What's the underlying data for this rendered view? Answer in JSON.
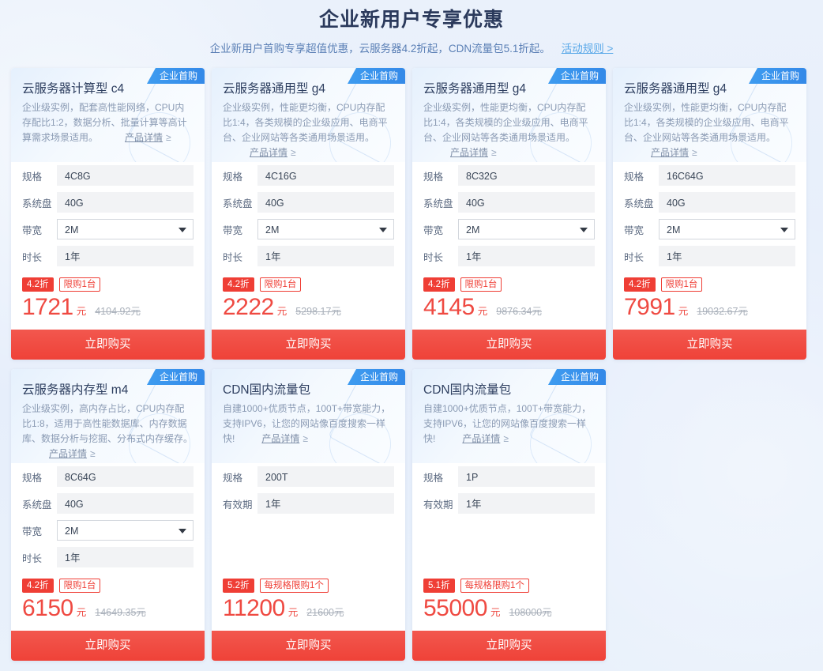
{
  "header": {
    "title": "企业新用户专享优惠",
    "subtitle": "企业新用户首购专享超值优惠，云服务器4.2折起，CDN流量包5.1折起。",
    "rule_link": "活动规则 >"
  },
  "labels": {
    "ribbon": "企业首购",
    "detail_link": "产品详情",
    "detail_chevron": "≥",
    "buy_button": "立即购买",
    "unit": "元",
    "unit_old": "元"
  },
  "colors": {
    "page_bg": "#e9f1fb",
    "title": "#2b3a5c",
    "subtitle": "#5a7fb5",
    "link": "#59a8e8",
    "ribbon": "#3489e8",
    "price_red": "#ef4a42",
    "tag_red": "#ef3e35",
    "buy_btn": "#ef4238",
    "field_bg": "#f2f3f5"
  },
  "cards": [
    {
      "title": "云服务器计算型 c4",
      "desc": "企业级实例，配套高性能网络，CPU内存配比1:2，数据分析、批量计算等高计算需求场景适用。",
      "specs": [
        {
          "label": "规格",
          "value": "4C8G",
          "type": "text"
        },
        {
          "label": "系统盘",
          "value": "40G",
          "type": "text"
        },
        {
          "label": "带宽",
          "value": "2M",
          "type": "select"
        },
        {
          "label": "时长",
          "value": "1年",
          "type": "text"
        }
      ],
      "discount": "4.2折",
      "limit": "限购1台",
      "price": "1721",
      "original_price": "4104.92"
    },
    {
      "title": "云服务器通用型 g4",
      "desc": "企业级实例，性能更均衡，CPU内存配比1:4，各类规模的企业级应用、电商平台、企业网站等各类通用场景适用。",
      "specs": [
        {
          "label": "规格",
          "value": "4C16G",
          "type": "text"
        },
        {
          "label": "系统盘",
          "value": "40G",
          "type": "text"
        },
        {
          "label": "带宽",
          "value": "2M",
          "type": "select"
        },
        {
          "label": "时长",
          "value": "1年",
          "type": "text"
        }
      ],
      "discount": "4.2折",
      "limit": "限购1台",
      "price": "2222",
      "original_price": "5298.17"
    },
    {
      "title": "云服务器通用型 g4",
      "desc": "企业级实例，性能更均衡，CPU内存配比1:4，各类规模的企业级应用、电商平台、企业网站等各类通用场景适用。",
      "specs": [
        {
          "label": "规格",
          "value": "8C32G",
          "type": "text"
        },
        {
          "label": "系统盘",
          "value": "40G",
          "type": "text"
        },
        {
          "label": "带宽",
          "value": "2M",
          "type": "select"
        },
        {
          "label": "时长",
          "value": "1年",
          "type": "text"
        }
      ],
      "discount": "4.2折",
      "limit": "限购1台",
      "price": "4145",
      "original_price": "9876.34"
    },
    {
      "title": "云服务器通用型 g4",
      "desc": "企业级实例，性能更均衡，CPU内存配比1:4，各类规模的企业级应用、电商平台、企业网站等各类通用场景适用。",
      "specs": [
        {
          "label": "规格",
          "value": "16C64G",
          "type": "text"
        },
        {
          "label": "系统盘",
          "value": "40G",
          "type": "text"
        },
        {
          "label": "带宽",
          "value": "2M",
          "type": "select"
        },
        {
          "label": "时长",
          "value": "1年",
          "type": "text"
        }
      ],
      "discount": "4.2折",
      "limit": "限购1台",
      "price": "7991",
      "original_price": "19032.67"
    },
    {
      "title": "云服务器内存型 m4",
      "desc": "企业级实例，高内存占比，CPU内存配比1:8，适用于高性能数据库、内存数据库、数据分析与挖掘、分布式内存缓存。",
      "specs": [
        {
          "label": "规格",
          "value": "8C64G",
          "type": "text"
        },
        {
          "label": "系统盘",
          "value": "40G",
          "type": "text"
        },
        {
          "label": "带宽",
          "value": "2M",
          "type": "select"
        },
        {
          "label": "时长",
          "value": "1年",
          "type": "text"
        }
      ],
      "discount": "4.2折",
      "limit": "限购1台",
      "price": "6150",
      "original_price": "14649.35"
    },
    {
      "title": "CDN国内流量包",
      "desc": "自建1000+优质节点，100T+带宽能力，支持IPV6，让您的网站像百度搜索一样快!",
      "specs": [
        {
          "label": "规格",
          "value": "200T",
          "type": "text"
        },
        {
          "label": "有效期",
          "value": "1年",
          "type": "text"
        }
      ],
      "discount": "5.2折",
      "limit": "每规格限购1个",
      "price": "11200",
      "original_price": "21600"
    },
    {
      "title": "CDN国内流量包",
      "desc": "自建1000+优质节点，100T+带宽能力，支持IPV6，让您的网站像百度搜索一样快!",
      "specs": [
        {
          "label": "规格",
          "value": "1P",
          "type": "text"
        },
        {
          "label": "有效期",
          "value": "1年",
          "type": "text"
        }
      ],
      "discount": "5.1折",
      "limit": "每规格限购1个",
      "price": "55000",
      "original_price": "108000"
    }
  ]
}
